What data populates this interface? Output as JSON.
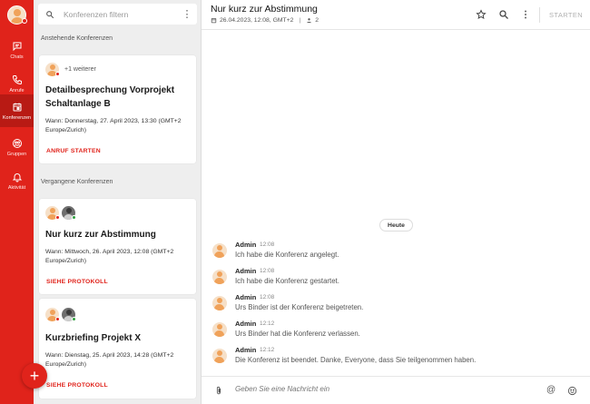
{
  "rail": {
    "items": [
      {
        "label": "Chats",
        "icon": "chat-icon"
      },
      {
        "label": "Anrufe",
        "icon": "phone-icon"
      },
      {
        "label": "Konferenzen",
        "icon": "calendar-icon",
        "active": true
      },
      {
        "label": "Gruppen",
        "icon": "group-icon"
      },
      {
        "label": "Aktivität",
        "icon": "bell-icon"
      }
    ],
    "fab_label": "+",
    "accent": "#e0231b"
  },
  "list": {
    "search_placeholder": "Konferenzen filtern",
    "upcoming_title": "Anstehende Konferenzen",
    "past_title": "Vergangene Konferenzen",
    "upcoming": [
      {
        "extra": "+1 weiterer",
        "title": "Detailbesprechung Vorprojekt Schaltanlage B",
        "when": "Wann: Donnerstag, 27. April 2023, 13:30 (GMT+2 Europe/Zurich)",
        "action": "ANRUF STARTEN"
      }
    ],
    "past": [
      {
        "title": "Nur kurz zur Abstimmung",
        "when": "Wann: Mittwoch, 26. April 2023, 12:08 (GMT+2 Europe/Zurich)",
        "action": "SIEHE PROTOKOLL"
      },
      {
        "title": "Kurzbriefing Projekt X",
        "when": "Wann: Dienstag, 25. April 2023, 14:28 (GMT+2 Europe/Zurich)",
        "action": "SIEHE PROTOKOLL"
      }
    ]
  },
  "chat": {
    "title": "Nur kurz zur Abstimmung",
    "meta_date": "26.04.2023, 12:08, GMT+2",
    "meta_separator": "|",
    "participants": "2",
    "start_label": "STARTEN",
    "day_label": "Heute",
    "messages": [
      {
        "author": "Admin",
        "time": "12:08",
        "text": "Ich habe die Konferenz angelegt."
      },
      {
        "author": "Admin",
        "time": "12:08",
        "text": "Ich habe die Konferenz gestartet."
      },
      {
        "author": "Admin",
        "time": "12:08",
        "text": "Urs Binder ist der Konferenz beigetreten."
      },
      {
        "author": "Admin",
        "time": "12:12",
        "text": "Urs Binder hat die Konferenz verlassen."
      },
      {
        "author": "Admin",
        "time": "12:12",
        "text": "Die Konferenz ist beendet. Danke, Everyone, dass Sie teilgenommen haben."
      }
    ],
    "composer_placeholder": "Geben Sie eine Nachricht ein",
    "at_symbol": "@"
  }
}
